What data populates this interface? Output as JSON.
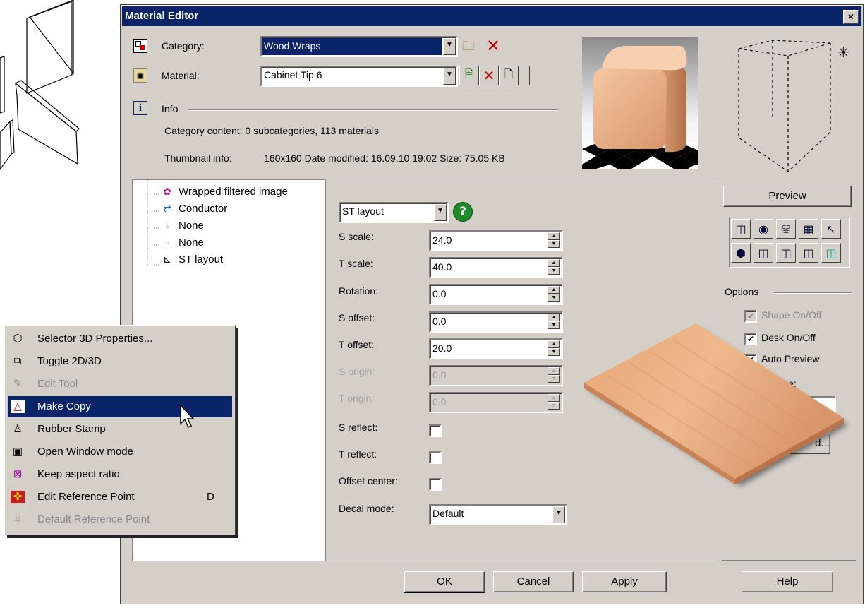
{
  "window": {
    "title": "Material Editor",
    "close_label": "×"
  },
  "category": {
    "label": "Category:",
    "value": "Wood Wraps"
  },
  "material": {
    "label": "Material:",
    "value": "Cabinet Tip 6"
  },
  "info": {
    "label": "Info",
    "category_content": "Category content: 0 subcategories,  113 materials",
    "thumbnail_label": "Thumbnail info:",
    "thumbnail_value": "160x160  Date modified: 16.09.10 19:02 Size: 75.05  KB"
  },
  "tree": [
    {
      "label": "Wrapped filtered image",
      "icon": "palette-icon"
    },
    {
      "label": "Conductor",
      "icon": "conductor-icon"
    },
    {
      "label": "None",
      "icon": "bulb-icon"
    },
    {
      "label": "None",
      "icon": "blank-icon"
    },
    {
      "label": "ST layout",
      "icon": "axes-icon"
    }
  ],
  "layout": {
    "selector_value": "ST layout",
    "fields": [
      {
        "label": "S scale:",
        "value": "24.0",
        "enabled": true
      },
      {
        "label": "T scale:",
        "value": "40.0",
        "enabled": true
      },
      {
        "label": "Rotation:",
        "value": "0.0",
        "enabled": true
      },
      {
        "label": "S offset:",
        "value": "0.0",
        "enabled": true
      },
      {
        "label": "T offset:",
        "value": "20.0",
        "enabled": true
      },
      {
        "label": "S origin:",
        "value": "0.0",
        "enabled": false
      },
      {
        "label": "T origin:",
        "value": "0.0",
        "enabled": false
      }
    ],
    "checks": [
      {
        "label": "S reflect:",
        "checked": false
      },
      {
        "label": "T reflect:",
        "checked": false
      },
      {
        "label": "Offset center:",
        "checked": false
      }
    ],
    "decal_label": "Decal mode:",
    "decal_value": "Default"
  },
  "preview": {
    "button_label": "Preview"
  },
  "options": {
    "label": "Options",
    "shape": {
      "label": "Shape On/Off",
      "checked": true,
      "enabled": false
    },
    "desk": {
      "label": "Desk On/Off",
      "checked": true
    },
    "auto_preview": {
      "label": "Auto Preview",
      "checked": true
    },
    "size_partial": "ize:",
    "advanced_partial": "d..."
  },
  "buttons": {
    "ok": "OK",
    "cancel": "Cancel",
    "apply": "Apply",
    "help": "Help"
  },
  "context_menu": [
    {
      "label": "Selector 3D Properties...",
      "shortcut": "",
      "state": "normal",
      "icon": "selector-3d-icon"
    },
    {
      "label": "Toggle 2D/3D",
      "shortcut": "",
      "state": "normal",
      "icon": "toggle-2d3d-icon"
    },
    {
      "label": "Edit Tool",
      "shortcut": "",
      "state": "disabled",
      "icon": "edit-tool-icon"
    },
    {
      "label": "Make Copy",
      "shortcut": "",
      "state": "highlighted",
      "icon": "make-copy-icon"
    },
    {
      "label": "Rubber Stamp",
      "shortcut": "",
      "state": "normal",
      "icon": "rubber-stamp-icon"
    },
    {
      "label": "Open Window mode",
      "shortcut": "",
      "state": "normal",
      "icon": "window-mode-icon"
    },
    {
      "label": "Keep aspect ratio",
      "shortcut": "",
      "state": "normal",
      "icon": "aspect-ratio-icon"
    },
    {
      "label": "Edit Reference Point",
      "shortcut": "D",
      "state": "normal",
      "icon": "reference-point-icon"
    },
    {
      "label": "Default Reference Point",
      "shortcut": "",
      "state": "disabled",
      "icon": "default-reference-icon"
    }
  ]
}
